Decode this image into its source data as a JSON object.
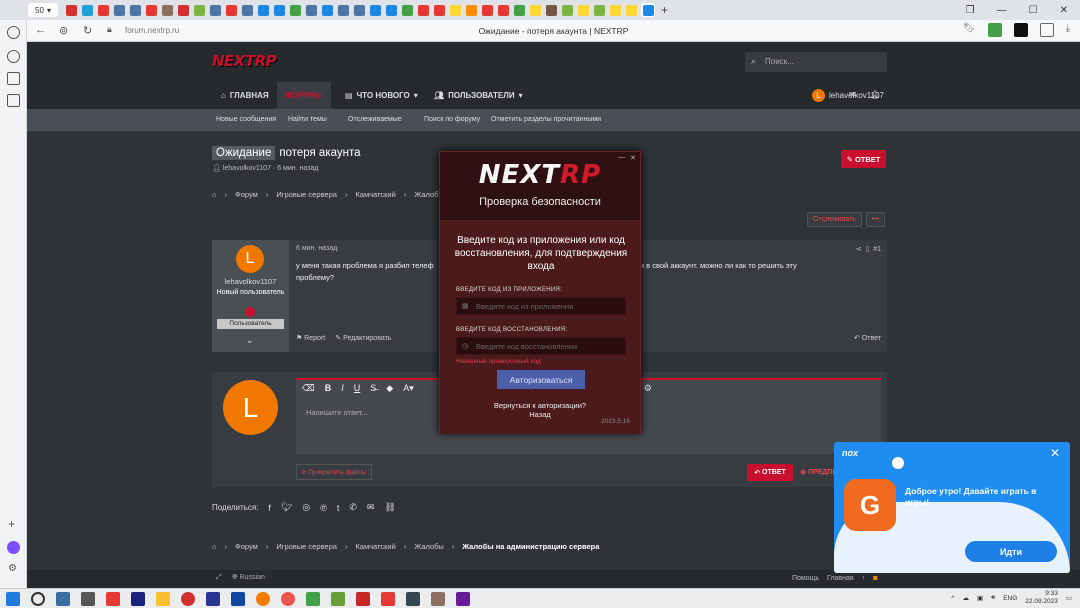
{
  "browser": {
    "tab_count": "50",
    "url": "forum.nextrp.ru",
    "page_title": "Ожидание - потеря акаунта | NEXTRP"
  },
  "site": {
    "logo": "NEXTRP",
    "search_placeholder": "Поиск...",
    "nav": {
      "home": "ГЛАВНАЯ",
      "forums": "ФОРУМЫ",
      "whats_new": "ЧТО НОВОГО",
      "users": "ПОЛЬЗОВАТЕЛИ"
    },
    "username": "lehavolkov1107",
    "avatar_letter": "L",
    "subnav": [
      "Новые сообщения",
      "Найти темы",
      "Отслеживаемые",
      "Поиск по форуму",
      "Отметить разделы прочитанными"
    ]
  },
  "thread": {
    "prefix": "Ожидание",
    "title": "потеря акаунта",
    "meta": "lehavolkov1107 · 6 мин. назад",
    "reply_button": "ОТВЕТ",
    "breadcrumbs": [
      "Форум",
      "Игровые сервера",
      "Камчатский",
      "Жалобы"
    ],
    "breadcrumbs_bottom": [
      "Форум",
      "Игровые сервера",
      "Камчатский",
      "Жалобы",
      "Жалобы на администрацию сервера"
    ],
    "watch_button": "Отслеживать",
    "more_button": "•••"
  },
  "post": {
    "author": "lehavolkov1107",
    "user_title": "Новый пользователь",
    "banner": "Пользователь",
    "date": "6 мин. назад",
    "number": "#1",
    "text_left": "у меня такая проблема я разбил телеф",
    "text_right": "ес я не могу войти в свой аккаунт. можно ли как то решить эту",
    "text_line2": "проблему?",
    "report": "Report",
    "edit": "Редактировать",
    "reply": "Ответ"
  },
  "editor": {
    "placeholder": "Напишите ответ...",
    "attach": "Прикрепить файлы",
    "reply_button": "ОТВЕТ",
    "preview_button": "ПРЕДПРОСМОТР"
  },
  "share": {
    "label": "Поделиться:"
  },
  "footer": {
    "language": "Russian",
    "links": [
      "Помощь",
      "Главная"
    ]
  },
  "modal": {
    "logo_white": "NEXT",
    "logo_red": "RP",
    "subtitle": "Проверка безопасности",
    "title": "Введите код из приложения или код восстановления, для подтверждения входа",
    "app_code_label": "ВВЕДИТЕ КОД ИЗ ПРИЛОЖЕНИЯ:",
    "app_code_placeholder": "Введите код из приложения",
    "recovery_label": "ВВЕДИТЕ КОД ВОССТАНОВЛЕНИЯ:",
    "recovery_placeholder": "Введите код восстановления",
    "error": "Неверный проверочный код",
    "auth_button": "Авторизоваться",
    "back_question": "Вернуться к авторизации?",
    "back_link": "Назад",
    "version": "2023.5.16"
  },
  "nox": {
    "brand": "nox",
    "message": "Доброе утро! Давайте играть в игры!",
    "button": "Идти"
  },
  "taskbar": {
    "lang": "ENG",
    "time": "9:33",
    "date": "22.09.2023"
  },
  "colors": {
    "accent": "#c8102e",
    "bg": "#2f3336",
    "nox_blue": "#1e8cf0"
  }
}
